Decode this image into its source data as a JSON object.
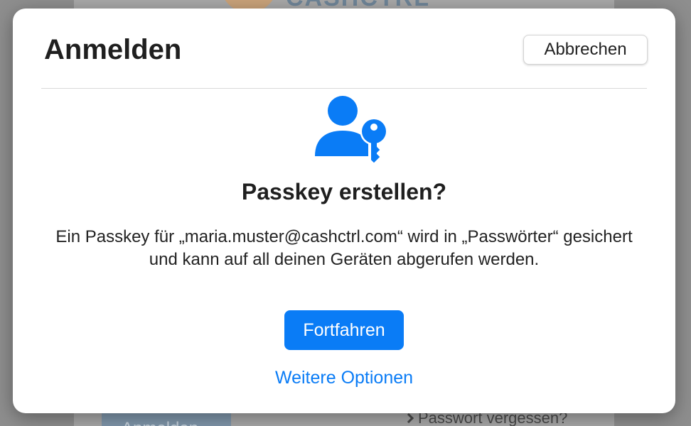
{
  "background": {
    "logo_text": "CASHCTRL",
    "login_button_label": "Anmelden",
    "forgot_password_link": "Passwort vergessen?"
  },
  "dialog": {
    "title": "Anmelden",
    "cancel_label": "Abbrechen",
    "icon": "person-key-icon",
    "heading": "Passkey erstellen?",
    "description": "Ein Passkey für „maria.muster@cashctrl.com“ wird in „Passwörter“ gesichert und kann auf all deinen Geräten abgerufen werden.",
    "continue_label": "Fortfahren",
    "more_options_label": "Weitere Optionen"
  },
  "colors": {
    "accent": "#0a7cf6",
    "dialog_bg": "#ffffff",
    "overlay": "#8e8e8e"
  }
}
